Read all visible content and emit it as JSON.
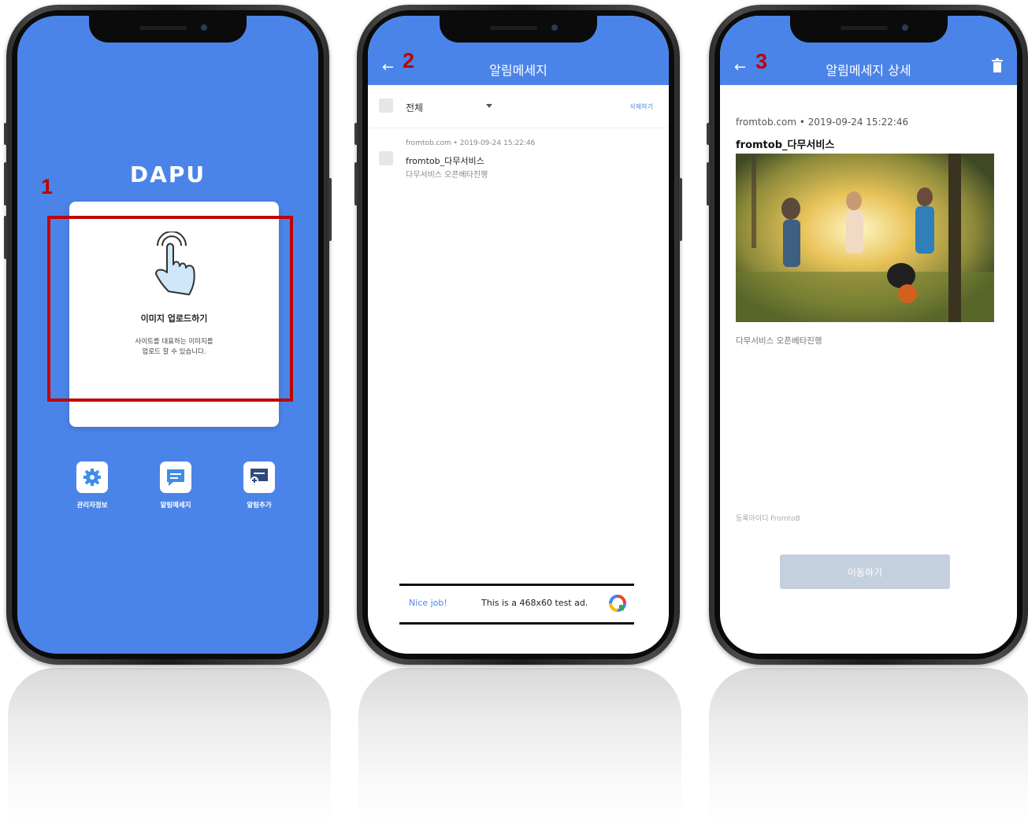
{
  "steps": {
    "one": "1",
    "two": "2",
    "three": "3"
  },
  "phone1": {
    "logo": "DAPU",
    "card_title": "이미지 업로드하기",
    "card_desc_line1": "사이트를 대표하는 이미지를",
    "card_desc_line2": "업로드 할 수 있습니다.",
    "menu": [
      {
        "label": "관리자정보",
        "icon": "gear-icon"
      },
      {
        "label": "알림메세지",
        "icon": "message-icon"
      },
      {
        "label": "알림추가",
        "icon": "add-message-icon"
      }
    ]
  },
  "phone2": {
    "header_title": "알림메세지",
    "select_all": "전체",
    "delete_label": "삭제하기",
    "message": {
      "meta": "fromtob.com • 2019-09-24 15:22:46",
      "title": "fromtob_다무서비스",
      "body": "다무서비스 오픈베타진행"
    },
    "ad": {
      "nice": "Nice job!",
      "text": "This is a 468x60 test ad."
    }
  },
  "phone3": {
    "header_title": "알림메세지 상세",
    "meta": "fromtob.com • 2019-09-24 15:22:46",
    "title": "fromtob_다무서비스",
    "body": "다무서비스 오픈베타진행",
    "reg_id": "등록아이디 FromtoB",
    "move_button": "이동하기"
  },
  "colors": {
    "accent": "#4b84e8",
    "annotation": "#c00000"
  }
}
